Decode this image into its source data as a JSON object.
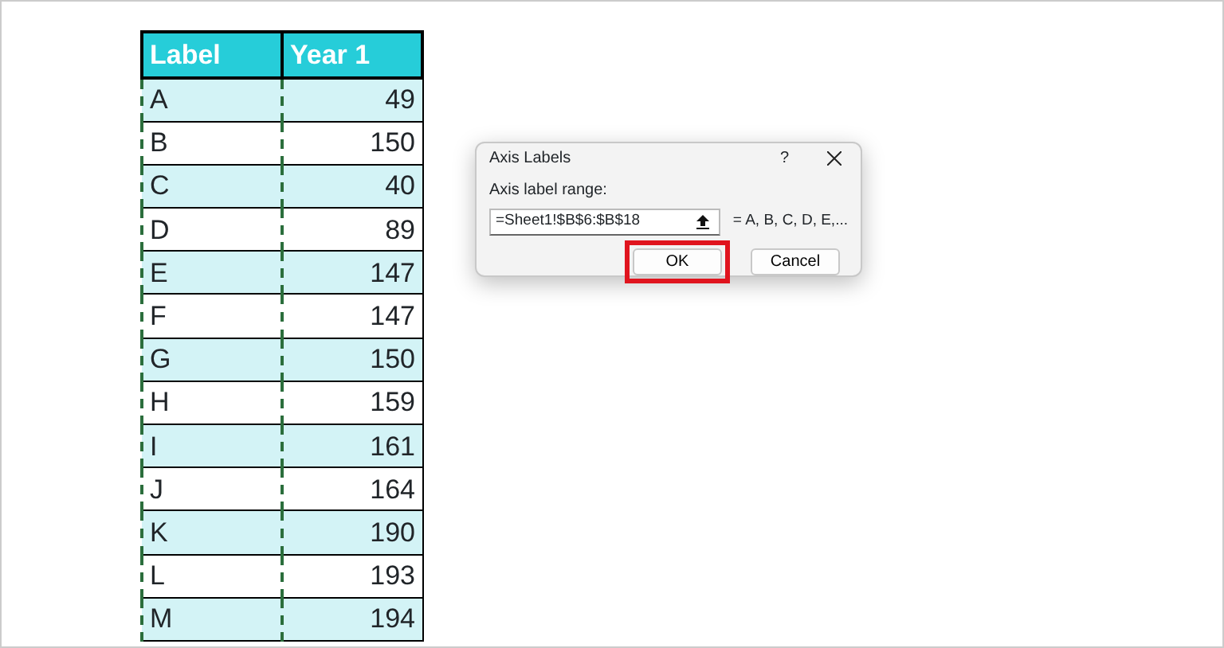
{
  "table": {
    "columns": [
      "Label",
      "Year 1"
    ],
    "label_column_marquee": true,
    "rows": [
      [
        "A",
        "49"
      ],
      [
        "B",
        "150"
      ],
      [
        "C",
        "40"
      ],
      [
        "D",
        "89"
      ],
      [
        "E",
        "147"
      ],
      [
        "F",
        "147"
      ],
      [
        "G",
        "150"
      ],
      [
        "H",
        "159"
      ],
      [
        "I",
        "161"
      ],
      [
        "J",
        "164"
      ],
      [
        "K",
        "190"
      ],
      [
        "L",
        "193"
      ],
      [
        "M",
        "194"
      ]
    ]
  },
  "dialog": {
    "title": "Axis Labels",
    "help": "?",
    "field_label": "Axis label range:",
    "field_value": "=Sheet1!$B$6:$B$18",
    "preview": "= A, B, C, D, E,...",
    "buttons": [
      {
        "label": "OK",
        "highlighted": true
      },
      {
        "label": "Cancel",
        "highlighted": false
      }
    ]
  }
}
